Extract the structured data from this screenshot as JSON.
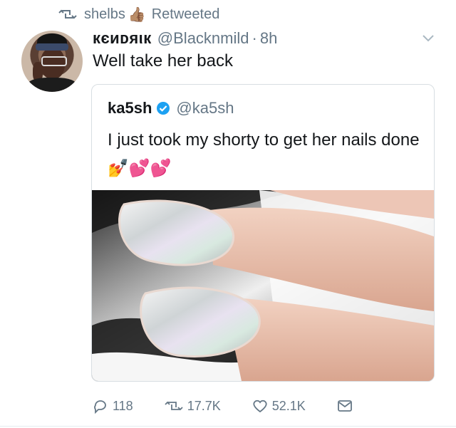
{
  "retweet": {
    "user": "shelbs",
    "thumb_emoji": "👍🏽",
    "label": "Retweeted"
  },
  "tweet": {
    "author_name": "кєиᴅяιк",
    "handle": "@Blacknmild",
    "separator": "·",
    "time": "8h",
    "text": "Well take her back"
  },
  "quote": {
    "author_name": "ka5sh",
    "handle": "@ka5sh",
    "text": "I just took my shorty to get her nails done",
    "emojis": "💅💕💕",
    "verified": true
  },
  "actions": {
    "replies": "118",
    "retweets": "17.7K",
    "likes": "52.1K"
  },
  "icons": [
    "retweet-icon",
    "thumb-emoji",
    "caret-down-icon",
    "verified-badge-icon",
    "reply-icon",
    "retweet-action-icon",
    "like-icon",
    "dm-icon"
  ],
  "colors": {
    "text": "#14171a",
    "secondary": "#657786",
    "verified": "#1da1f2",
    "border": "#d8dee2"
  }
}
